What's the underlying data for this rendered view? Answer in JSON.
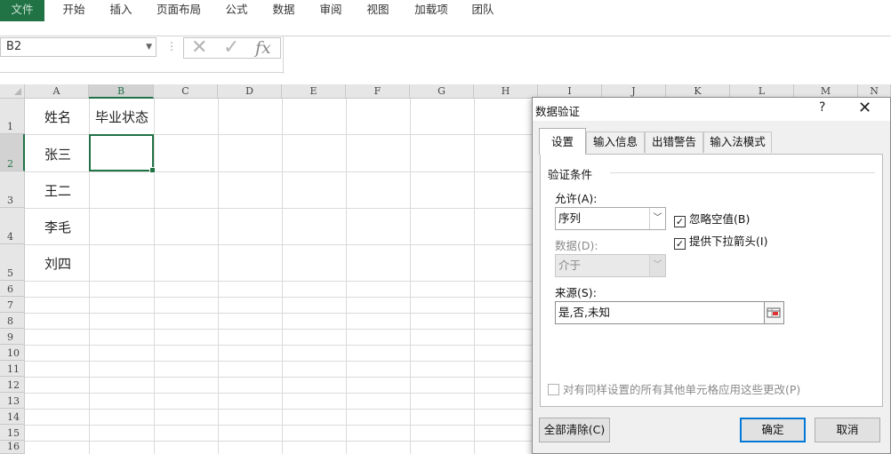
{
  "ribbon": {
    "tabs": [
      "文件",
      "开始",
      "插入",
      "页面布局",
      "公式",
      "数据",
      "审阅",
      "视图",
      "加载项",
      "团队"
    ]
  },
  "formula_bar": {
    "name_box": "B2",
    "cancel_glyph": "✕",
    "enter_glyph": "✓",
    "fx_label": "fx",
    "content": ""
  },
  "sheet": {
    "columns": [
      "A",
      "B",
      "C",
      "D",
      "E",
      "F",
      "G",
      "H",
      "I",
      "J",
      "K",
      "L",
      "M",
      "N"
    ],
    "rows": [
      "1",
      "2",
      "3",
      "4",
      "5",
      "6",
      "7",
      "8",
      "9",
      "10",
      "11",
      "12",
      "13",
      "14",
      "15",
      "16"
    ],
    "cells": {
      "A1": "姓名",
      "B1": "毕业状态",
      "A2": "张三",
      "A3": "王二",
      "A4": "李毛",
      "A5": "刘四"
    },
    "selected_cell": "B2"
  },
  "dialog": {
    "title": "数据验证",
    "help": "?",
    "close": "✕",
    "tabs": [
      "设置",
      "输入信息",
      "出错警告",
      "输入法模式"
    ],
    "active_tab": "设置",
    "group_label": "验证条件",
    "allow_label": "允许(A):",
    "allow_value": "序列",
    "data_label": "数据(D):",
    "data_value": "介于",
    "ignore_blank_label": "忽略空值(B)",
    "ignore_blank_checked": true,
    "dropdown_label": "提供下拉箭头(I)",
    "dropdown_checked": true,
    "source_label": "来源(S):",
    "source_value": "是,否,未知",
    "apply_all_label": "对有同样设置的所有其他单元格应用这些更改(P)",
    "apply_all_checked": false,
    "clear_all": "全部清除(C)",
    "ok": "确定",
    "cancel": "取消"
  },
  "colors": {
    "accent": "#217346",
    "focus": "#0078d7"
  }
}
